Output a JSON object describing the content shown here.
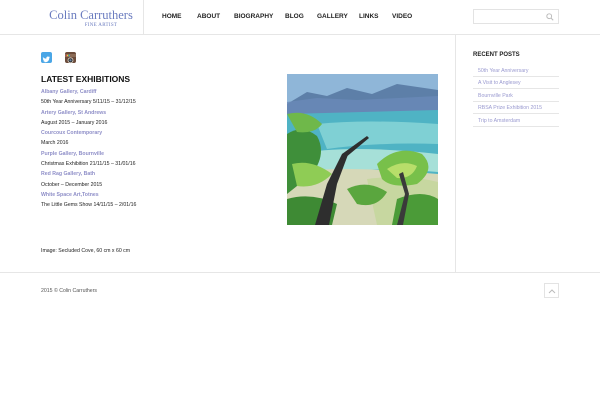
{
  "logo": {
    "name": "Colin Carruthers",
    "subtitle": "FINE ARTIST"
  },
  "nav": [
    {
      "label": "HOME"
    },
    {
      "label": "ABOUT"
    },
    {
      "label": "BIOGRAPHY"
    },
    {
      "label": "BLOG"
    },
    {
      "label": "GALLERY"
    },
    {
      "label": "LINKS"
    },
    {
      "label": "VIDEO"
    }
  ],
  "search": {
    "value": "",
    "placeholder": "",
    "icon": "search-icon"
  },
  "social": [
    {
      "icon": "twitter-icon",
      "color": "#4aa6e6"
    },
    {
      "icon": "instagram-icon",
      "color": "#6b4b3a"
    }
  ],
  "main": {
    "title": "LATEST EXHIBITIONS",
    "exhibitions": [
      {
        "gallery": "Albany Gallery, Cardiff",
        "detail": "50th Year Anniversary 5/11/15 – 31/12/15"
      },
      {
        "gallery": "Artery Gallery, St Andrews",
        "detail": "August 2015 – January 2016"
      },
      {
        "gallery": "Courcoux Contemporary",
        "detail": "March 2016"
      },
      {
        "gallery": "Purple Gallery, Bournville",
        "detail": "Christmas Exhibition 21/11/15 –  31/01/16"
      },
      {
        "gallery": "Red Rag Gallery, Bath",
        "detail": "October – December 2015"
      },
      {
        "gallery": "White Space Art,Totnes",
        "detail": "The Little Gems Show 14/11/15 – 2/01/16"
      }
    ],
    "caption": "Image: Secluded Cove,  60 cm x 60 cm"
  },
  "sidebar": {
    "title": "RECENT POSTS",
    "posts": [
      {
        "label": "50th Year Anniversary"
      },
      {
        "label": "A Visit to Anglesey"
      },
      {
        "label": "Bournville Park"
      },
      {
        "label": "RBSA Prize Exhibition 2015"
      },
      {
        "label": "Trip to Amsterdam"
      }
    ]
  },
  "footer": {
    "copyright": "2015 © Colin Carruthers",
    "back_to_top_icon": "chevron-up-icon"
  },
  "colors": {
    "accent": "#8f8fc8",
    "logo": "#6a7bbf",
    "border": "#e6e6e6"
  }
}
